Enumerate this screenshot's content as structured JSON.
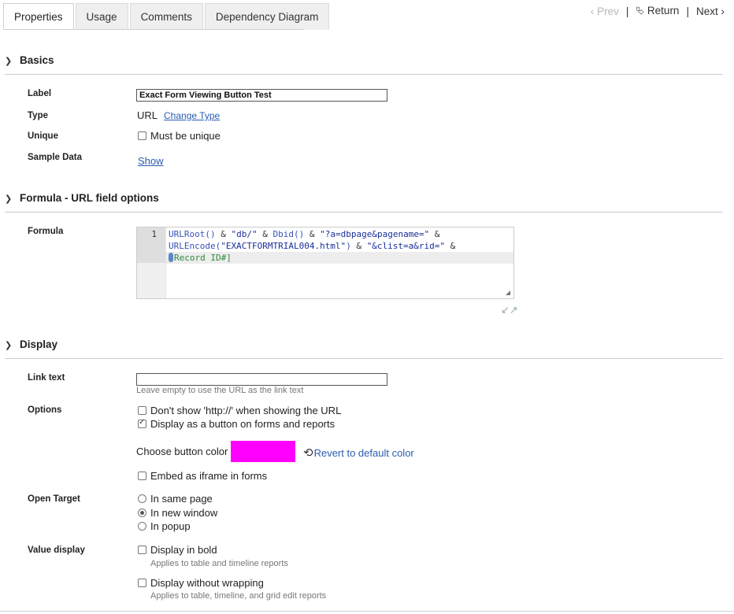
{
  "tabs": [
    {
      "label": "Properties",
      "active": true
    },
    {
      "label": "Usage",
      "active": false
    },
    {
      "label": "Comments",
      "active": false
    },
    {
      "label": "Dependency Diagram",
      "active": false
    }
  ],
  "nav": {
    "prev": "Prev",
    "ret": "Return",
    "next": "Next",
    "separator": "|"
  },
  "basics": {
    "title": "Basics",
    "label_label": "Label",
    "label_value": "Exact Form Viewing Button Test",
    "type_label": "Type",
    "type_value": "URL",
    "change_type": "Change Type",
    "unique_label": "Unique",
    "unique_option": "Must be unique",
    "sample_label": "Sample Data",
    "sample_link": "Show"
  },
  "formula": {
    "title": "Formula - URL field options",
    "label": "Formula",
    "line_number": "1",
    "line1": {
      "fn1": "URLRoot()",
      "op1": " & ",
      "s1": "\"db/\"",
      "op2": " & ",
      "fn2": "Dbid()",
      "op3": " & ",
      "s2": "\"?a=dbpage&pagename=\"",
      "op4": " &"
    },
    "line2": {
      "fn": "URLEncode(",
      "s1": "\"EXACTFORMTRIAL004.html\"",
      "cl": ")",
      "op1": " & ",
      "s2": "\"&clist=a&rid=\"",
      "op2": " &"
    },
    "line3": {
      "field": "Record ID#]"
    }
  },
  "display": {
    "title": "Display",
    "link_text_label": "Link text",
    "link_text_value": "",
    "link_text_hint": "Leave empty to use the URL as the link text",
    "options_label": "Options",
    "opt_no_http": "Don't show 'http://' when showing the URL",
    "opt_button": "Display as a button on forms and reports",
    "choose_color": "Choose button color",
    "button_color": "#ff00ff",
    "revert": "Revert to default color",
    "opt_iframe": "Embed as iframe in forms",
    "open_target_label": "Open Target",
    "target_same": "In same page",
    "target_new": "In new window",
    "target_popup": "In popup",
    "value_display_label": "Value display",
    "bold": "Display in bold",
    "bold_hint": "Applies to table and timeline reports",
    "nowrap": "Display without wrapping",
    "nowrap_hint": "Applies to table, timeline, and grid edit reports"
  }
}
